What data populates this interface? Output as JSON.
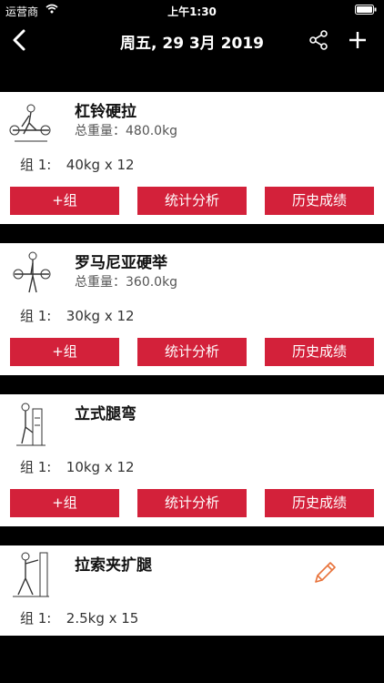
{
  "status_bar": {
    "carrier": "运营商",
    "time": "上午1:30"
  },
  "nav": {
    "title": "周五, 29 3月 2019",
    "back_icon": "chevron-left-icon",
    "share_icon": "share-icon",
    "add_icon": "plus-icon"
  },
  "buttons": {
    "add_set": "+组",
    "stats": "统计分析",
    "history": "历史成绩"
  },
  "colors": {
    "accent": "#d3213a",
    "edit": "#e8723a"
  },
  "exercises": [
    {
      "name": "杠铃硬拉",
      "total": "总重量：480.0kg",
      "set_label": "组 1:",
      "set_value": "40kg x 12"
    },
    {
      "name": "罗马尼亚硬举",
      "total": "总重量：360.0kg",
      "set_label": "组 1:",
      "set_value": "30kg x 12"
    },
    {
      "name": "立式腿弯",
      "total": "",
      "set_label": "组 1:",
      "set_value": "10kg x 12"
    },
    {
      "name": "拉索夹扩腿",
      "total": "",
      "set_label": "组 1:",
      "set_value": "2.5kg x 15"
    }
  ]
}
